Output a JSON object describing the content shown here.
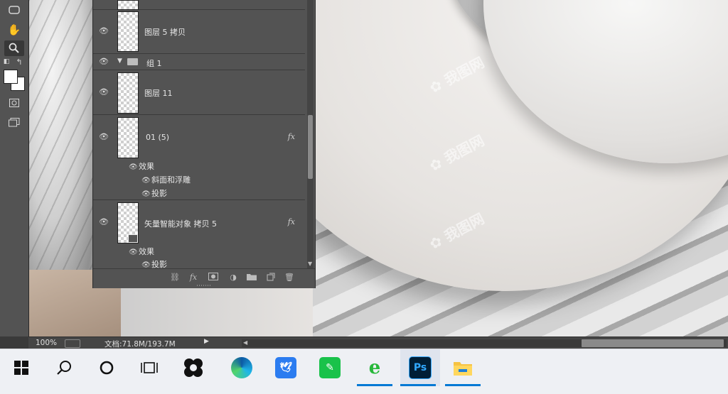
{
  "toolbar": {
    "tools": [
      "rounded-rect-tool-icon",
      "hand-tool-icon",
      "zoom-tool-icon",
      "default-colors-icon",
      "swap-colors-icon",
      "color-swatches",
      "quick-mask-icon",
      "screen-mode-icon"
    ]
  },
  "layers": [
    {
      "name": "图层 5 拷贝"
    },
    {
      "group": "组 1"
    },
    {
      "name": "图层 11"
    },
    {
      "name": "01 (5)",
      "fx": "fx",
      "effects_label": "效果",
      "effects": [
        "斜面和浮雕",
        "投影"
      ]
    },
    {
      "name": "矢量智能对象 拷贝 5",
      "fx": "fx",
      "effects_label": "效果",
      "effects": [
        "投影"
      ]
    }
  ],
  "statusbar": {
    "zoom": "100%",
    "doc_info": "文档:71.8M/193.7M"
  },
  "taskbar": {
    "items": [
      {
        "icon": "windows-start-icon"
      },
      {
        "icon": "search-icon"
      },
      {
        "icon": "cortana-icon"
      },
      {
        "icon": "task-view-icon"
      },
      {
        "icon": "app-icon"
      },
      {
        "icon": "edge-icon"
      },
      {
        "icon": "feishu-icon"
      },
      {
        "icon": "green-app-icon"
      },
      {
        "icon": "ie-browser-icon",
        "running": true
      },
      {
        "icon": "photoshop-icon",
        "label": "Ps",
        "running": true,
        "active": true
      },
      {
        "icon": "file-explorer-icon",
        "running": true
      }
    ]
  },
  "colors": {
    "ps_blue": "#31a8ff",
    "ps_bg": "#001e36",
    "taskbar_accent": "#0078d4",
    "panel_bg": "#535353"
  }
}
